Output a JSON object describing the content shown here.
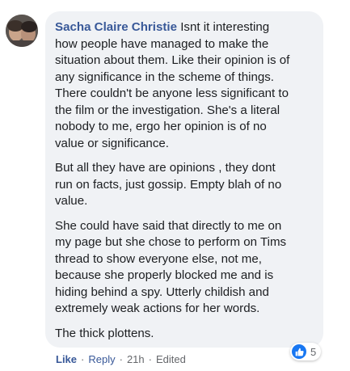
{
  "comment": {
    "author": "Sacha Claire Christie",
    "paragraphs": [
      "Isnt it interesting\nhow people have managed to make the\nsituation about them. Like their opinion is of\nany significance in the scheme of things.\nThere couldn't be anyone less significant to\nthe film or the investigation. She's a literal\nnobody to me, ergo her opinion is of no\nvalue or significance.",
      "But all they have are opinions , they dont\nrun on facts, just gossip. Empty blah of no\nvalue.",
      "She could have said that directly to me on\nmy page but she chose to perform on Tims\nthread to show everyone else, not me,\nbecause she properly blocked me and is\nhiding behind a spy. Utterly childish and\nextremely weak actions for her words.",
      "The thick plottens."
    ],
    "reactions": {
      "icon": "thumbs-up-icon",
      "count": "5"
    },
    "actions": {
      "like": "Like",
      "reply": "Reply",
      "time": "21h",
      "edited": "Edited",
      "separator": "·"
    }
  },
  "colors": {
    "author": "#385898",
    "bubble": "#f0f2f5",
    "like_blue": "#1877f2",
    "meta": "#65676b"
  }
}
